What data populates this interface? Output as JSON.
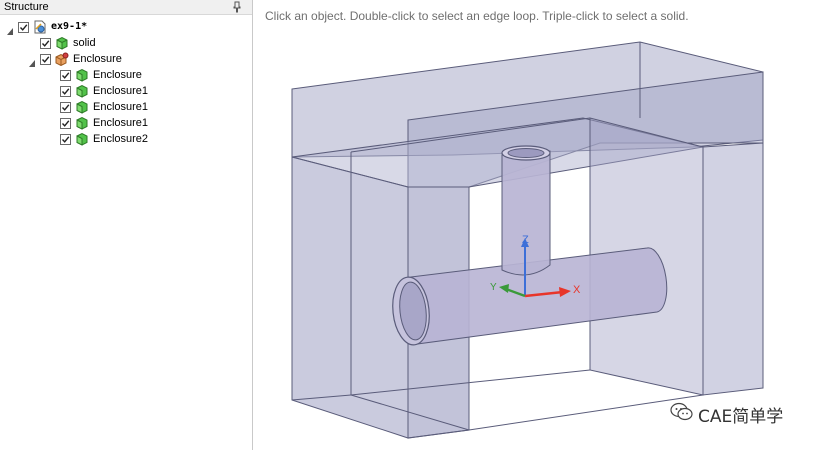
{
  "structure": {
    "title": "Structure",
    "items": [
      {
        "label": "ex9-1*",
        "icon": "document-icon",
        "expanded": true,
        "checked": true
      },
      {
        "label": "solid",
        "icon": "solid-body-icon",
        "checked": true
      },
      {
        "label": "Enclosure",
        "icon": "enclosure-group-icon",
        "expanded": true,
        "checked": true
      },
      {
        "label": "Enclosure",
        "icon": "solid-body-icon",
        "checked": true
      },
      {
        "label": "Enclosure1",
        "icon": "solid-body-icon",
        "checked": true
      },
      {
        "label": "Enclosure1",
        "icon": "solid-body-icon",
        "checked": true
      },
      {
        "label": "Enclosure1",
        "icon": "solid-body-icon",
        "checked": true
      },
      {
        "label": "Enclosure2",
        "icon": "solid-body-icon",
        "checked": true
      }
    ]
  },
  "viewport": {
    "hint": "Click an object. Double-click to select an edge loop. Triple-click to select a solid.",
    "triad": {
      "x_label": "X",
      "y_label": "Y",
      "z_label": "Z",
      "x_color": "#e8352a",
      "y_color": "#3a9a3a",
      "z_color": "#3d6fd8"
    }
  },
  "watermark": {
    "text": "CAE简单学",
    "icon": "wechat-icon"
  },
  "colors": {
    "enclosure_fill": "#9ea0c4",
    "pipe_fill": "#b8b4d4",
    "edge": "#5a5c7a",
    "hint": "#6f6f6f"
  }
}
